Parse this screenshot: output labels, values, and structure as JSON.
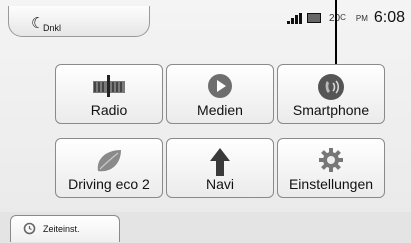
{
  "top_bar": {
    "night_mode_label": "Dnkl",
    "status": {
      "temperature": "20",
      "temperature_unit": "C",
      "am_pm": "PM",
      "time": "6:08"
    }
  },
  "tiles": [
    {
      "label": "Radio",
      "icon": "radio-icon"
    },
    {
      "label": "Medien",
      "icon": "media-play-icon"
    },
    {
      "label": "Smartphone",
      "icon": "smartphone-icon"
    },
    {
      "label": "Driving eco 2",
      "icon": "eco-leaf-icon"
    },
    {
      "label": "Navi",
      "icon": "navigation-arrow-icon"
    },
    {
      "label": "Einstellungen",
      "icon": "gear-icon"
    }
  ],
  "bottom_bar": {
    "time_settings_label": "Zeiteinst."
  }
}
